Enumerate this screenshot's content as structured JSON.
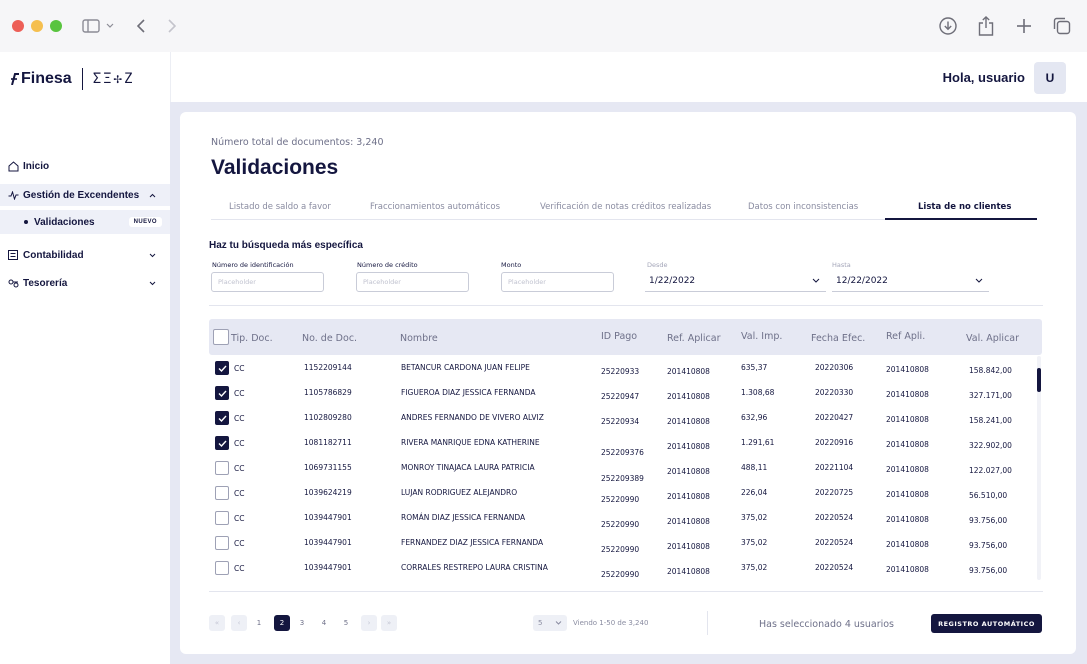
{
  "browser": {
    "icons": [
      "sidebar-toggle-icon",
      "chevron-down-icon",
      "back-arrow-icon",
      "forward-arrow-icon",
      "download-icon",
      "share-icon",
      "plus-icon",
      "tabs-icon"
    ]
  },
  "header": {
    "logo_text": "Finesa",
    "logo_secondary": "ΣΞ✢Z",
    "greeting": "Hola, usuario",
    "avatar_initial": "U"
  },
  "sidebar": {
    "inicio": "Inicio",
    "gestion": "Gestión de Excendentes",
    "validaciones": "Validaciones",
    "badge_nuevo": "NUEVO",
    "contabilidad": "Contabilidad",
    "tesoreria": "Tesorería"
  },
  "main": {
    "doc_count": "Número total de documentos: 3,240",
    "title": "Validaciones",
    "tabs": [
      {
        "label": "Listado de saldo a favor"
      },
      {
        "label": "Fraccionamientos automáticos"
      },
      {
        "label": "Verificación de notas créditos realizadas"
      },
      {
        "label": "Datos con inconsistencias"
      },
      {
        "label": "Lista de no clientes"
      }
    ],
    "active_tab": "Lista de no clientes"
  },
  "filters": {
    "title": "Haz tu búsqueda más específica",
    "id_label": "Número de identificación",
    "id_placeholder": "Placeholder",
    "credit_label": "Número de crédito",
    "credit_placeholder": "Placeholder",
    "amount_label": "Monto",
    "amount_placeholder": "Placeholder",
    "from_label": "Desde",
    "from_value": "1/22/2022",
    "to_label": "Hasta",
    "to_value": "12/22/2022"
  },
  "table": {
    "headers": [
      "Tip. Doc.",
      "No. de Doc.",
      "Nombre",
      "ID Pago",
      "Ref. Aplicar",
      "Val. Imp.",
      "Fecha Efec.",
      "Ref Apli.",
      "Val. Aplicar"
    ],
    "rows": [
      {
        "checked": true,
        "tip": "CC",
        "doc": "1152209144",
        "nombre": "BETANCUR CARDONA JUAN FELIPE",
        "id_pago": "25220933",
        "ref_aplicar": "201410808",
        "val_imp": "635,37",
        "fecha": "20220306",
        "ref_apli": "201410808",
        "val_aplicar": "158.842,00"
      },
      {
        "checked": true,
        "tip": "CC",
        "doc": "1105786829",
        "nombre": "FIGUEROA DIAZ JESSICA FERNANDA",
        "id_pago": "25220947",
        "ref_aplicar": "201410808",
        "val_imp": "1.308,68",
        "fecha": "20220330",
        "ref_apli": "201410808",
        "val_aplicar": "327.171,00"
      },
      {
        "checked": true,
        "tip": "CC",
        "doc": "1102809280",
        "nombre": "ANDRES FERNANDO DE VIVERO ALVIZ",
        "id_pago": "25220934",
        "ref_aplicar": "201410808",
        "val_imp": "632,96",
        "fecha": "20220427",
        "ref_apli": "201410808",
        "val_aplicar": "158.241,00"
      },
      {
        "checked": true,
        "tip": "CC",
        "doc": "1081182711",
        "nombre": "RIVERA MANRIQUE EDNA KATHERINE",
        "id_pago": "252209376",
        "ref_aplicar": "201410808",
        "val_imp": "1.291,61",
        "fecha": "20220916",
        "ref_apli": "201410808",
        "val_aplicar": "322.902,00"
      },
      {
        "checked": false,
        "tip": "CC",
        "doc": "1069731155",
        "nombre": "MONROY TINAJACA LAURA PATRICIA",
        "id_pago": "252209389",
        "ref_aplicar": "201410808",
        "val_imp": "488,11",
        "fecha": "20221104",
        "ref_apli": "201410808",
        "val_aplicar": "122.027,00"
      },
      {
        "checked": false,
        "tip": "CC",
        "doc": "1039624219",
        "nombre": "LUJAN RODRIGUEZ ALEJANDRO",
        "id_pago": "25220990",
        "ref_aplicar": "201410808",
        "val_imp": "226,04",
        "fecha": "20220725",
        "ref_apli": "201410808",
        "val_aplicar": "56.510,00"
      },
      {
        "checked": false,
        "tip": "CC",
        "doc": "1039447901",
        "nombre": "ROMÁN DIAZ JESSICA FERNANDA",
        "id_pago": "25220990",
        "ref_aplicar": "201410808",
        "val_imp": "375,02",
        "fecha": "20220524",
        "ref_apli": "201410808",
        "val_aplicar": "93.756,00"
      },
      {
        "checked": false,
        "tip": "CC",
        "doc": "1039447901",
        "nombre": "FERNANDEZ DIAZ JESSICA FERNANDA",
        "id_pago": "25220990",
        "ref_aplicar": "201410808",
        "val_imp": "375,02",
        "fecha": "20220524",
        "ref_apli": "201410808",
        "val_aplicar": "93.756,00"
      },
      {
        "checked": false,
        "tip": "CC",
        "doc": "1039447901",
        "nombre": "CORRALES RESTREPO LAURA CRISTINA",
        "id_pago": "25220990",
        "ref_aplicar": "201410808",
        "val_imp": "375,02",
        "fecha": "20220524",
        "ref_apli": "201410808",
        "val_aplicar": "93.756,00"
      }
    ]
  },
  "footer": {
    "pages": [
      "1",
      "2",
      "3",
      "4",
      "5"
    ],
    "current_page": "2",
    "per_page": "5",
    "viewing": "Viendo  1-50 de 3,240",
    "selected_text": "Has seleccionado 4 usuarios",
    "registro_button": "REGISTRO AUTOMÁTICO"
  },
  "colors": {
    "primary": "#14163f",
    "background": "#e6e8f3",
    "muted_text": "#6e7089"
  }
}
